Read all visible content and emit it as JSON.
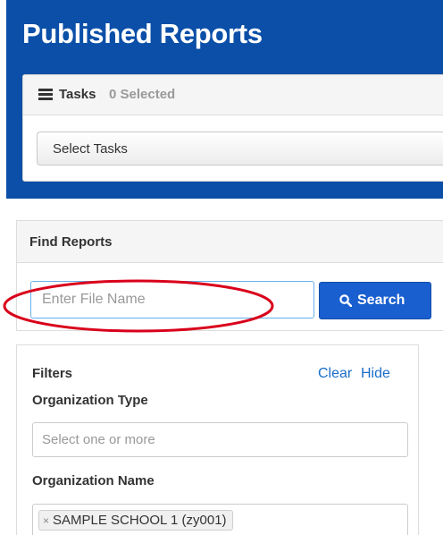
{
  "page": {
    "title": "Published Reports"
  },
  "tasks": {
    "label": "Tasks",
    "count": "0 Selected",
    "select_label": "Select Tasks",
    "icon": "list-icon"
  },
  "find_reports": {
    "title": "Find Reports",
    "input_placeholder": "Enter File Name",
    "input_value": "",
    "search_label": "Search",
    "search_icon": "search-icon"
  },
  "filters": {
    "title": "Filters",
    "clear_label": "Clear",
    "hide_label": "Hide",
    "org_type_label": "Organization Type",
    "org_type_placeholder": "Select one or more",
    "org_name_label": "Organization Name",
    "selected_orgs": [
      "SAMPLE SCHOOL 1 (zy001)"
    ],
    "remove_glyph": "×"
  },
  "colors": {
    "header_bg": "#0b4fa8",
    "primary_button": "#1a5fcf",
    "link": "#1a6ec8",
    "highlight_ring": "#d9001b"
  }
}
